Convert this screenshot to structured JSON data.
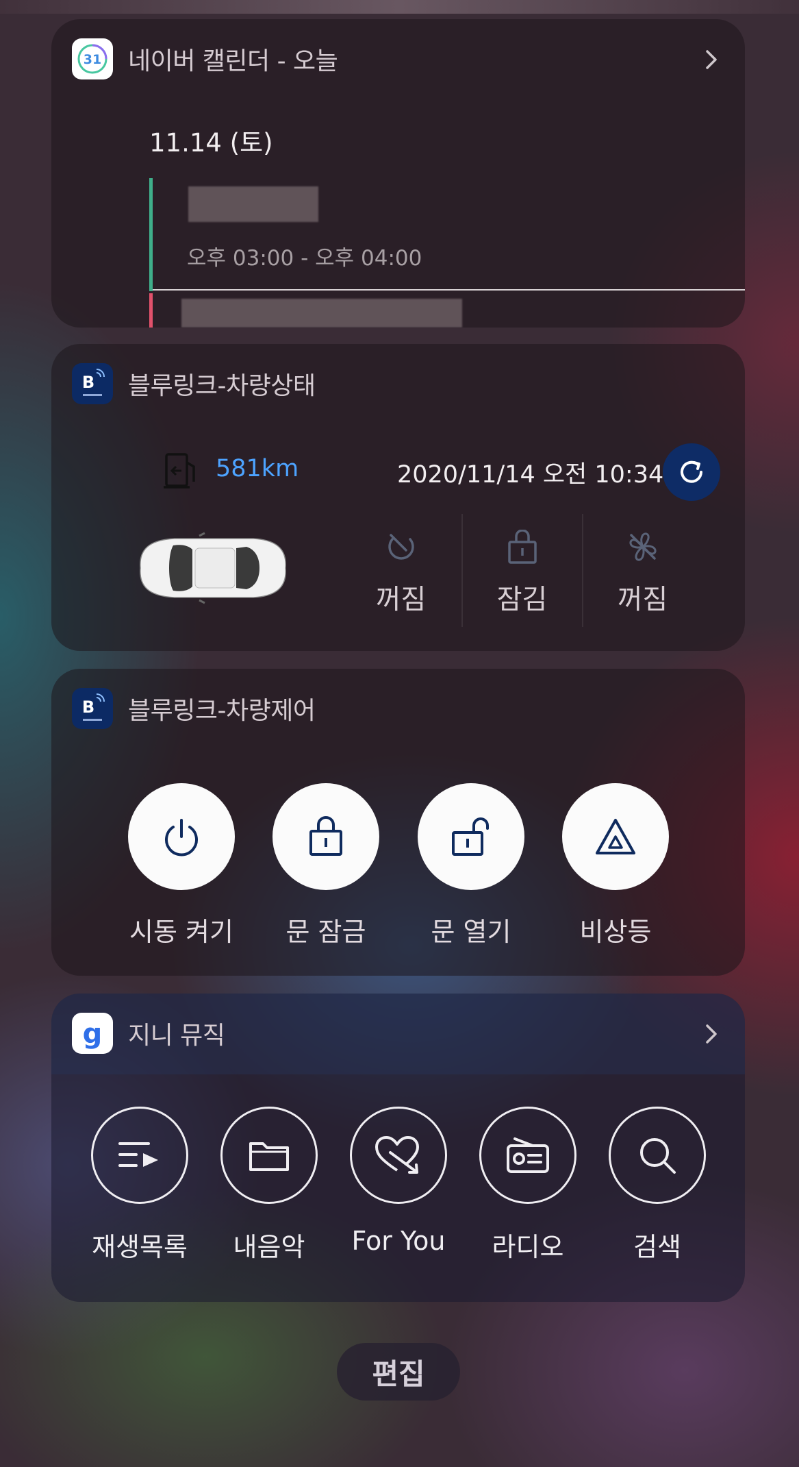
{
  "calendar": {
    "app_name": "네이버 캘린더 - 오늘",
    "app_icon_text": "31",
    "date": "11.14 (토)",
    "event_time": "오후 03:00 - 오후 04:00"
  },
  "vehicle_status": {
    "app_name": "블루링크-차량상태",
    "app_icon_text": "B",
    "range": "581km",
    "updated": "2020/11/14 오전 10:34",
    "items": [
      {
        "icon": "engine-off-icon",
        "label": "꺼짐"
      },
      {
        "icon": "lock-icon",
        "label": "잠김"
      },
      {
        "icon": "fan-off-icon",
        "label": "꺼짐"
      }
    ]
  },
  "vehicle_control": {
    "app_name": "블루링크-차량제어",
    "app_icon_text": "B",
    "buttons": [
      {
        "icon": "power-icon",
        "label": "시동 켜기"
      },
      {
        "icon": "lock-icon",
        "label": "문 잠금"
      },
      {
        "icon": "unlock-icon",
        "label": "문 열기"
      },
      {
        "icon": "hazard-icon",
        "label": "비상등"
      }
    ]
  },
  "music": {
    "app_name": "지니 뮤직",
    "app_icon_text": "g",
    "buttons": [
      {
        "icon": "playlist-icon",
        "label": "재생목록"
      },
      {
        "icon": "folder-icon",
        "label": "내음악"
      },
      {
        "icon": "heart-arrow-icon",
        "label": "For You"
      },
      {
        "icon": "radio-icon",
        "label": "라디오"
      },
      {
        "icon": "search-icon",
        "label": "검색"
      }
    ]
  },
  "edit_label": "편집",
  "colors": {
    "accent_blue": "#4da3ff",
    "bluelink_navy": "#0e2c66",
    "calendar_green": "#3fae8a",
    "calendar_red": "#e0516b"
  }
}
